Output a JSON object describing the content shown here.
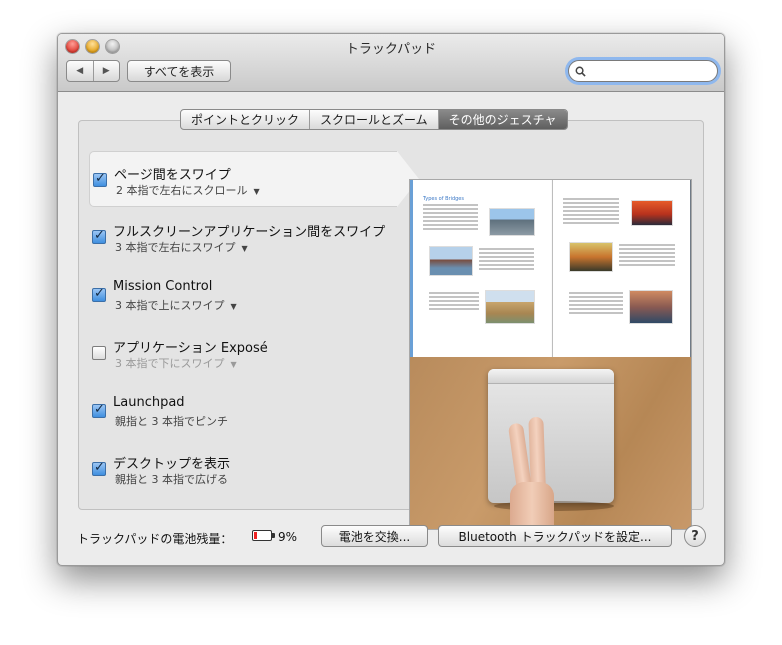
{
  "window": {
    "title": "トラックパッド"
  },
  "toolbar": {
    "back_icon": "◀",
    "forward_icon": "▶",
    "show_all_label": "すべてを表示",
    "search_value": "",
    "search_icon": "magnifier-icon"
  },
  "tabs": [
    {
      "label": "ポイントとクリック",
      "active": false
    },
    {
      "label": "スクロールとズーム",
      "active": false
    },
    {
      "label": "その他のジェスチャ",
      "active": true
    }
  ],
  "gestures": [
    {
      "title": "ページ間をスワイプ",
      "subtitle": "2 本指で左右にスクロール",
      "checked": true,
      "has_menu": true,
      "selected": true
    },
    {
      "title": "フルスクリーンアプリケーション間をスワイプ",
      "subtitle": "3 本指で左右にスワイプ",
      "checked": true,
      "has_menu": true
    },
    {
      "title": "Mission Control",
      "subtitle": "3 本指で上にスワイプ",
      "checked": true,
      "has_menu": true
    },
    {
      "title": "アプリケーション Exposé",
      "subtitle": "3 本指で下にスワイプ",
      "checked": false,
      "has_menu": true,
      "disabled": true
    },
    {
      "title": "Launchpad",
      "subtitle": "親指と 3 本指でピンチ",
      "checked": true,
      "has_menu": false
    },
    {
      "title": "デスクトップを表示",
      "subtitle": "親指と 3 本指で広げる",
      "checked": true,
      "has_menu": false
    }
  ],
  "preview": {
    "doc_heading": "Types of Bridges"
  },
  "footer": {
    "battery_label": "トラックパッドの電池残量：",
    "battery_percent": "9%",
    "replace_battery_label": "電池を交換...",
    "bluetooth_setup_label": "Bluetooth トラックパッドを設定...",
    "help_label": "?"
  },
  "colors": {
    "checkbox_checked": "#3f8fdf",
    "active_tab": "#6e6e6e",
    "search_focus_ring": "#8fb8ee",
    "battery_low": "#e22222"
  }
}
